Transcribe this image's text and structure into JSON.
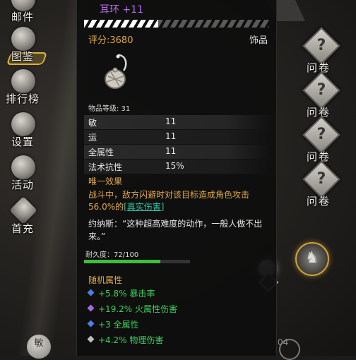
{
  "left_menu": [
    {
      "label": "邮件",
      "icon": "mail-icon"
    },
    {
      "label": "图鉴",
      "icon": "book-icon"
    },
    {
      "label": "排行榜",
      "icon": "ranking-icon"
    },
    {
      "label": "设置",
      "icon": "gear-icon"
    },
    {
      "label": "活动",
      "icon": "activity-icon"
    },
    {
      "label": "首充",
      "icon": "first-charge-icon"
    }
  ],
  "right_menu": [
    {
      "label": "问卷",
      "glyph": "?"
    },
    {
      "label": "问卷",
      "glyph": "?"
    },
    {
      "label": "问卷",
      "glyph": "?"
    },
    {
      "label": "问卷",
      "glyph": "?"
    }
  ],
  "tooltip": {
    "item_name": "耳环 +11",
    "score": "评分:3680",
    "category": "饰品",
    "item_level": "物品等级: 31",
    "stats": [
      {
        "name": "敏",
        "value": "11"
      },
      {
        "name": "运",
        "value": "11"
      },
      {
        "name": "全属性",
        "value": "11"
      },
      {
        "name": "法术抗性",
        "value": "15%"
      }
    ],
    "unique_header": "唯一效果",
    "unique_effect_prefix": "战斗中，敌方闪避时对该目标造成角色攻击 56.0%的",
    "unique_effect_link": "[真实伤害]",
    "quote": "约纳斯：“这种超高难度的动作，一般人做不出来。”",
    "durability_label": "耐久度：72/100",
    "durability_fraction": 0.72,
    "random_header": "随机属性",
    "affixes": [
      {
        "text": "+5.8% 暴击率",
        "gem_color": "#4d7fe6"
      },
      {
        "text": "+19.2% 火属性伤害",
        "gem_color": "#a86ae6"
      },
      {
        "text": "+3 全属性",
        "gem_color": "#4d7fe6"
      },
      {
        "text": "+4.2% 物理伤害",
        "gem_color": "#bdbdbd"
      }
    ]
  },
  "bottom": {
    "badge_label": "敏",
    "number": "04"
  },
  "colors": {
    "item_name": "#b46ee6",
    "gold": "#e0a84a",
    "green": "#3ecf5c",
    "true_damage": "#2fc4a2"
  }
}
